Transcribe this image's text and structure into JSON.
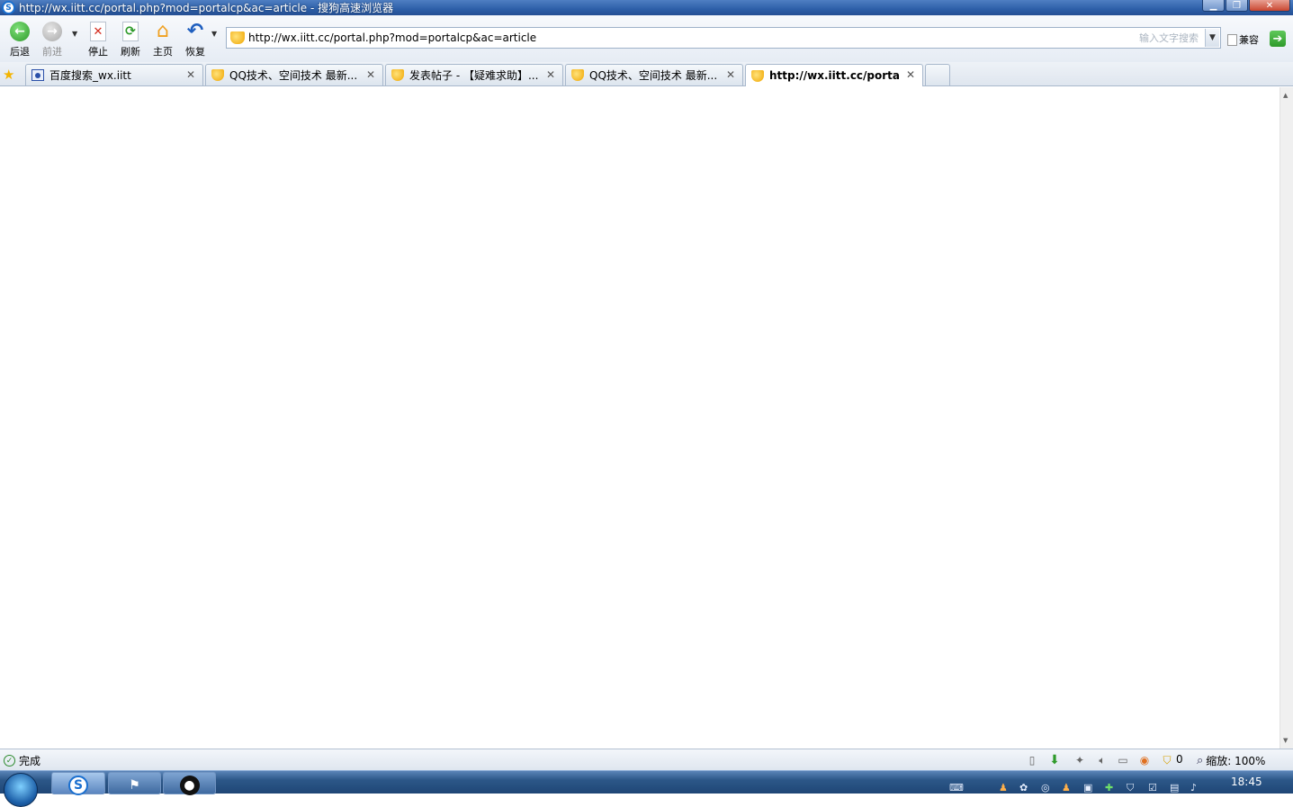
{
  "window": {
    "title": "http://wx.iitt.cc/portal.php?mod=portalcp&ac=article - 搜狗高速浏览器",
    "app_icon_letter": "S"
  },
  "toolbar": {
    "back_label": "后退",
    "forward_label": "前进",
    "stop_label": "停止",
    "refresh_label": "刷新",
    "home_label": "主页",
    "restore_label": "恢复"
  },
  "address": {
    "url": "http://wx.iitt.cc/portal.php?mod=portalcp&ac=article",
    "search_placeholder": "输入文字搜索"
  },
  "compat": {
    "label": "兼容"
  },
  "tabs": [
    {
      "label": "百度搜索_wx.iitt",
      "icon": "baidu-icon",
      "active": false
    },
    {
      "label": "QQ技术、空间技术 最新...",
      "icon": "site-shield-icon",
      "active": false
    },
    {
      "label": "发表帖子 - 【疑难求助】...",
      "icon": "site-shield-icon",
      "active": false
    },
    {
      "label": "QQ技术、空间技术 最新...",
      "icon": "site-shield-icon",
      "active": false
    },
    {
      "label": "http://wx.iitt.cc/porta...",
      "icon": "site-shield-icon",
      "active": true
    }
  ],
  "status": {
    "text": "完成",
    "count": "0",
    "zoom": "缩放: 100%"
  },
  "taskbar": {
    "clock": "18:45"
  },
  "colors": {
    "titlebar": "#2d5fa8",
    "back_green": "#2e9a2a",
    "taskbar": "#2c5788"
  }
}
